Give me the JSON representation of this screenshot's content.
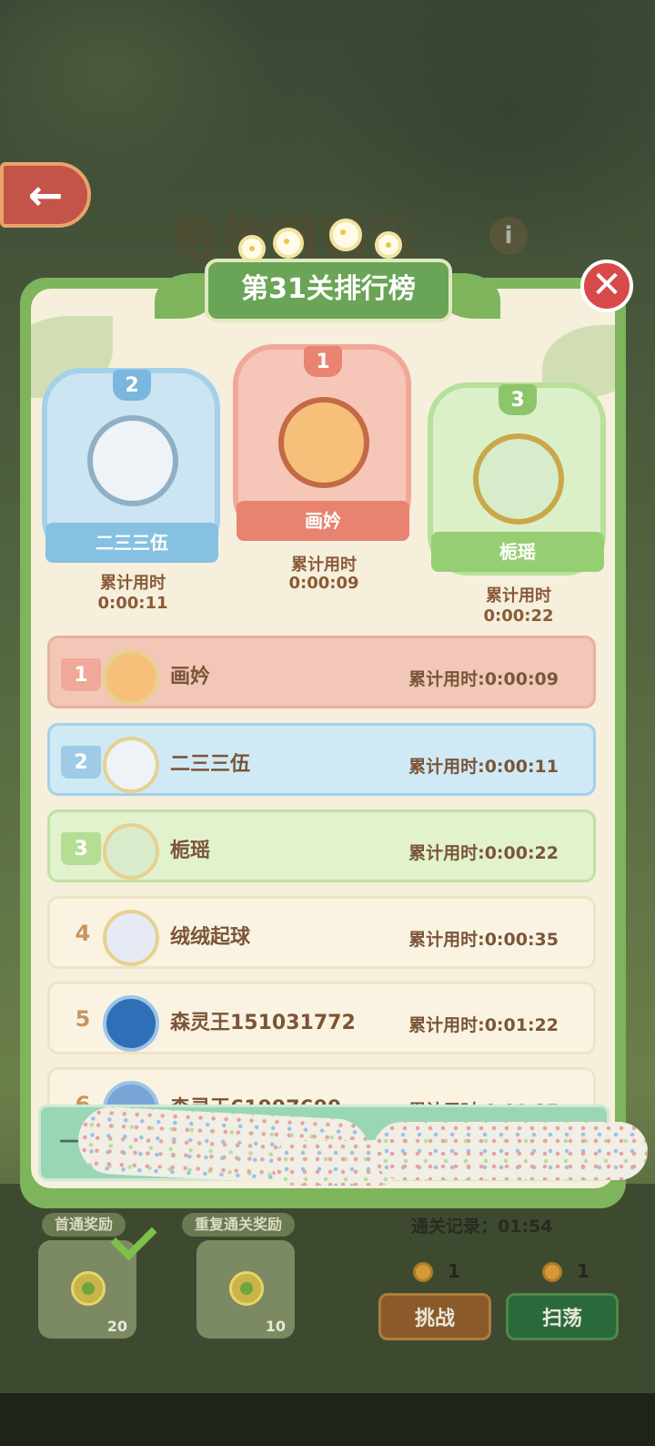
{
  "background": {
    "title": "抱抱钢钢乐",
    "back_arrow": "←",
    "info_glyph": "i",
    "first_clear_label": "首通奖励",
    "repeat_clear_label": "重复通关奖励",
    "first_clear_count": "20",
    "repeat_clear_count": "10",
    "record_label": "通关记录：01:54",
    "challenge_cost": "1",
    "sweep_cost": "1",
    "challenge_button": "挑战",
    "sweep_button": "扫荡"
  },
  "modal": {
    "title": "第31关排行榜",
    "close_glyph": "✕"
  },
  "podium": {
    "first": {
      "rank": "1",
      "name": "画妗",
      "time_label": "累计用时",
      "time": "0:00:09"
    },
    "second": {
      "rank": "2",
      "name": "二三三伍",
      "time_label": "累计用时",
      "time": "0:00:11"
    },
    "third": {
      "rank": "3",
      "name": "栀瑶",
      "time_label": "累计用时",
      "time": "0:00:22"
    }
  },
  "rankings": [
    {
      "rank": "1",
      "name": "画妗",
      "time": "累计用时:0:00:09"
    },
    {
      "rank": "2",
      "name": "二三三伍",
      "time": "累计用时:0:00:11"
    },
    {
      "rank": "3",
      "name": "栀瑶",
      "time": "累计用时:0:00:22"
    },
    {
      "rank": "4",
      "name": "绒绒起球",
      "time": "累计用时:0:00:35"
    },
    {
      "rank": "5",
      "name": "森灵王151031772",
      "time": "累计用时:0:01:22"
    },
    {
      "rank": "6",
      "name": "森灵王61997699",
      "time": "累计用时:0:01:27"
    }
  ],
  "self_row": {
    "dash": "—"
  },
  "colors": {
    "gold": "#f2c7b8",
    "silver": "#cfeaf4",
    "bronze": "#e2f2cd",
    "normal": "#fbf3e2",
    "accent_green": "#6aa456",
    "close_red": "#d84a4a"
  }
}
